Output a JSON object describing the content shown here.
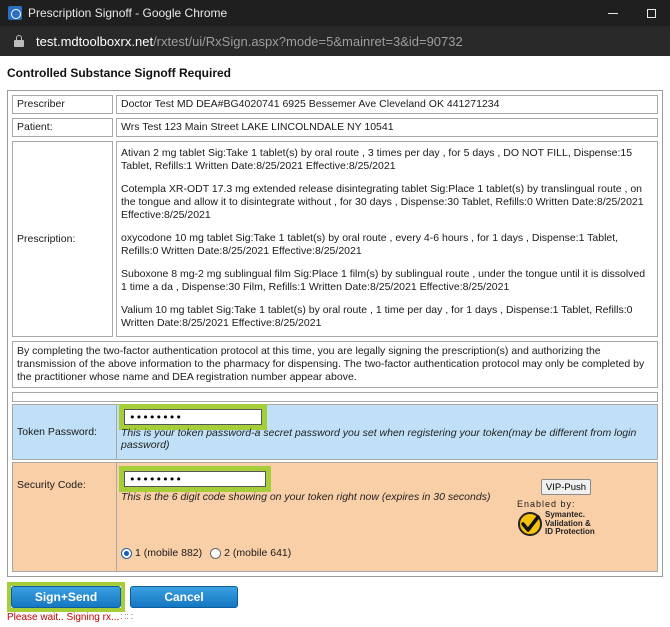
{
  "window": {
    "title": "Prescription Signoff - Google Chrome",
    "url_host": "test.mdtoolboxrx.net",
    "url_path": "/rxtest/ui/RxSign.aspx?mode=5&mainret=3&id=90732"
  },
  "page": {
    "heading": "Controlled Substance Signoff Required"
  },
  "prescriber": {
    "label": "Prescriber",
    "value": "Doctor Test MD DEA#BG4020741 6925 Bessemer Ave Cleveland OK 441271234"
  },
  "patient": {
    "label": "Patient:",
    "value": "Wrs Test 123 Main Street LAKE LINCOLNDALE NY 10541"
  },
  "prescription": {
    "label": "Prescription:",
    "items": [
      "Ativan 2 mg tablet Sig:Take 1 tablet(s) by oral route , 3 times per day , for 5 days , DO NOT FILL, Dispense:15 Tablet, Refills:1 Written Date:8/25/2021 Effective:8/25/2021",
      "Cotempla XR-ODT 17.3 mg extended release disintegrating tablet Sig:Place 1 tablet(s) by translingual route , on the tongue and allow it to disintegrate without , for 30 days , Dispense:30 Tablet, Refills:0 Written Date:8/25/2021 Effective:8/25/2021",
      "oxycodone 10 mg tablet Sig:Take 1 tablet(s) by oral route , every 4-6 hours , for 1 days , Dispense:1 Tablet, Refills:0 Written Date:8/25/2021 Effective:8/25/2021",
      "Suboxone 8 mg-2 mg sublingual film Sig:Place 1 film(s) by sublingual route , under the tongue until it is dissolved 1 time a da , Dispense:30 Film, Refills:1 Written Date:8/25/2021 Effective:8/25/2021",
      "Valium 10 mg tablet Sig:Take 1 tablet(s) by oral route , 1 time per day , for 1 days , Dispense:1 Tablet, Refills:0 Written Date:8/25/2021 Effective:8/25/2021"
    ]
  },
  "legal_notice": "By completing the two-factor authentication protocol at this time, you are legally signing the prescription(s) and authorizing the transmission of the above information to the pharmacy for dispensing. The two-factor authentication protocol may only be completed by the practitioner whose name and DEA registration number appear above.",
  "token": {
    "label": "Token Password:",
    "value": "••••••••",
    "hint": "This is your token password-a secret password you set when registering your token(may be different from login password)",
    "bg_color": "#bfe0f7"
  },
  "security": {
    "label": "Security Code:",
    "value": "••••••••",
    "hint": "This is the 6 digit code showing on your token right now (expires in 30 seconds)",
    "vip_button": "VIP-Push",
    "enabled_by": "Enabled by:",
    "logo_lines": [
      "Symantec.",
      "Validation &",
      "ID Protection"
    ],
    "bg_color": "#f9cfa8",
    "radio_options": [
      {
        "label": "1 (mobile 882)",
        "selected": true
      },
      {
        "label": "2 (mobile 641)",
        "selected": false
      }
    ]
  },
  "actions": {
    "sign_label": "Sign+Send",
    "cancel_label": "Cancel"
  },
  "status": {
    "wait_text": "Please wait.. Signing rx...",
    "wait_suffix": " ∷∷"
  },
  "colors": {
    "highlight": "#a6ce39",
    "button_blue": "#1577c2",
    "status_red": "#c00000"
  },
  "icons": {
    "app": "chrome-icon",
    "lock": "lock-icon",
    "logo": "symantec-check-icon"
  }
}
